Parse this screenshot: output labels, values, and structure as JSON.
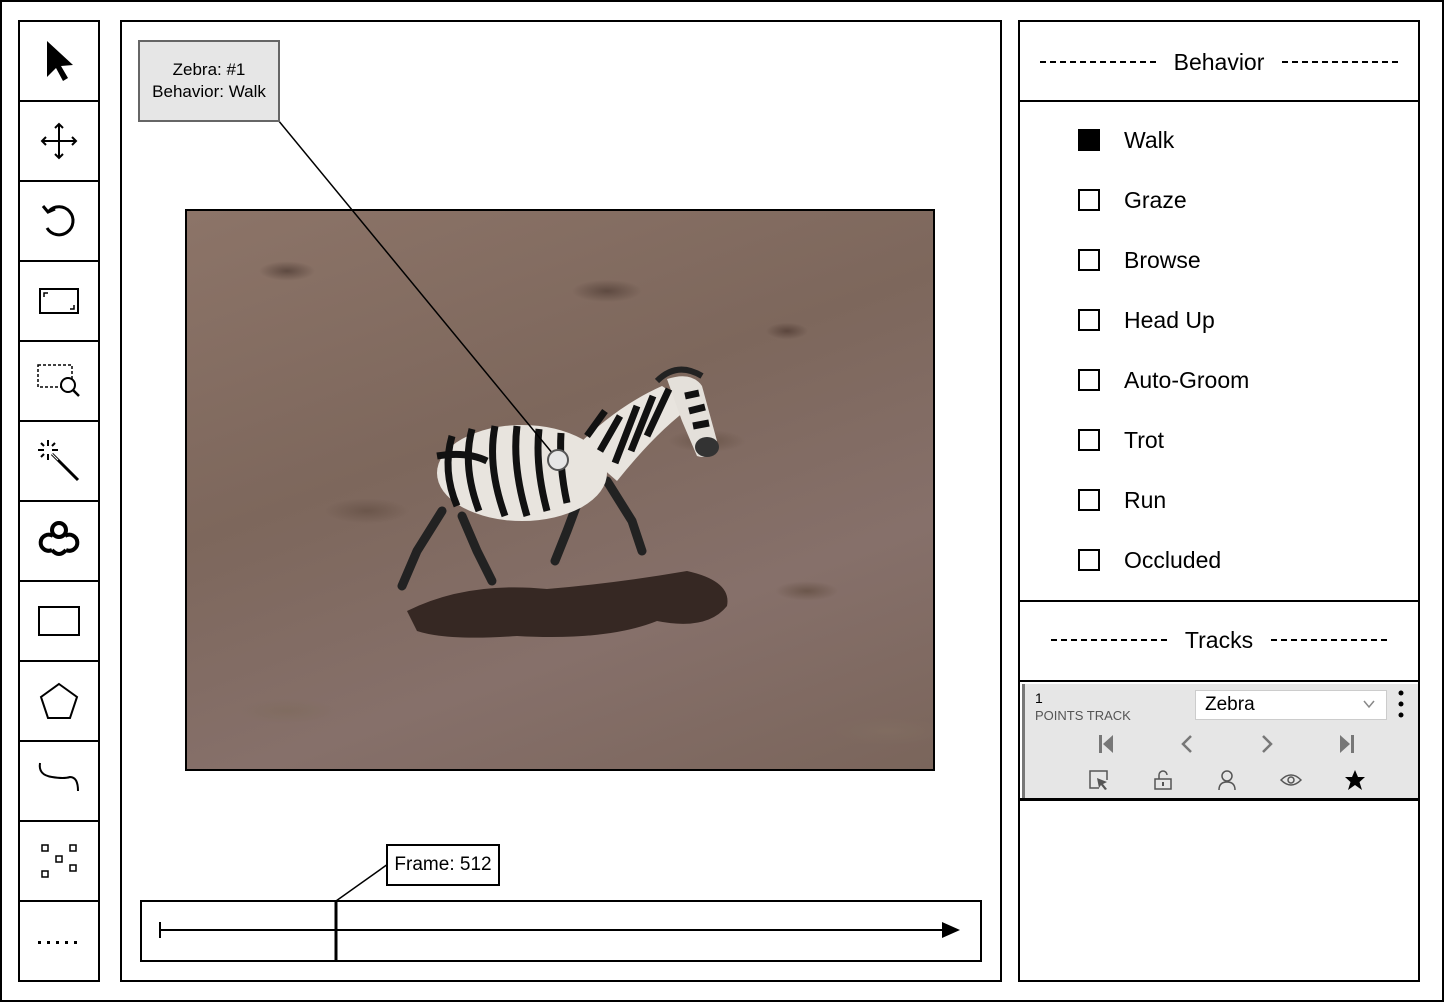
{
  "toolbar": {
    "tools": [
      {
        "name": "select-tool",
        "icon": "cursor-arrow-icon"
      },
      {
        "name": "move-tool",
        "icon": "move-arrows-icon"
      },
      {
        "name": "rotate-tool",
        "icon": "rotate-ccw-icon"
      },
      {
        "name": "fit-screen-tool",
        "icon": "fit-screen-icon"
      },
      {
        "name": "zoom-region-tool",
        "icon": "zoom-region-icon"
      },
      {
        "name": "magic-wand-tool",
        "icon": "magic-wand-icon"
      },
      {
        "name": "openvino-tool",
        "icon": "openvino-icon"
      },
      {
        "name": "rectangle-tool",
        "icon": "rectangle-icon"
      },
      {
        "name": "polygon-tool",
        "icon": "pentagon-icon"
      },
      {
        "name": "polyline-tool",
        "icon": "polyline-icon"
      },
      {
        "name": "points-tool",
        "icon": "points-icon"
      },
      {
        "name": "more-tools",
        "icon": "dotted-line-icon"
      }
    ]
  },
  "canvas": {
    "annotation": {
      "line1": "Zebra: #1",
      "line2": "Behavior: Walk"
    },
    "frame_label": "Frame: 512"
  },
  "behavior": {
    "title": "Behavior",
    "options": [
      {
        "label": "Walk",
        "checked": true
      },
      {
        "label": "Graze",
        "checked": false
      },
      {
        "label": "Browse",
        "checked": false
      },
      {
        "label": "Head Up",
        "checked": false
      },
      {
        "label": "Auto-Groom",
        "checked": false
      },
      {
        "label": "Trot",
        "checked": false
      },
      {
        "label": "Run",
        "checked": false
      },
      {
        "label": "Occluded",
        "checked": false
      }
    ]
  },
  "tracks": {
    "title": "Tracks",
    "items": [
      {
        "id": "1",
        "type": "POINTS TRACK",
        "label": "Zebra"
      }
    ]
  }
}
